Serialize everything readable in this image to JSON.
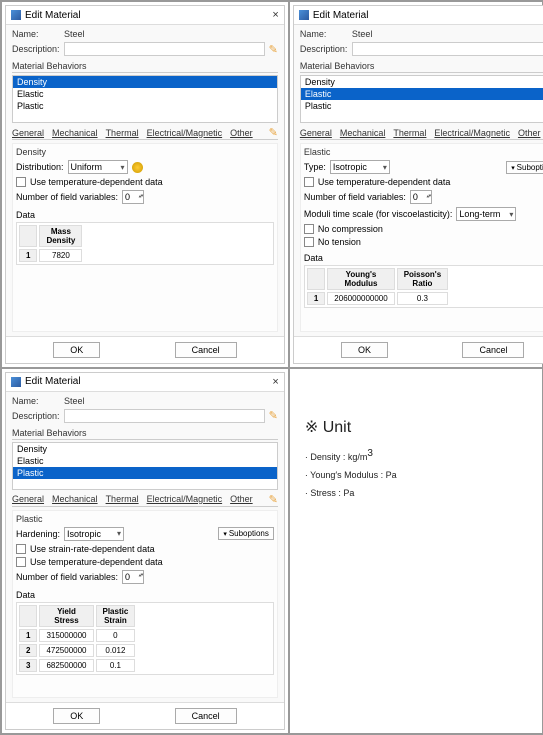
{
  "dialog_title": "Edit Material",
  "name_label": "Name:",
  "name_value": "Steel",
  "desc_label": "Description:",
  "behaviors_label": "Material Behaviors",
  "behaviors": [
    "Density",
    "Elastic",
    "Plastic"
  ],
  "tabs": {
    "general": "General",
    "mechanical": "Mechanical",
    "thermal": "Thermal",
    "electrical": "Electrical/Magnetic",
    "other": "Other"
  },
  "density": {
    "title": "Density",
    "distribution_label": "Distribution:",
    "distribution_value": "Uniform",
    "use_temp": "Use temperature-dependent data",
    "nfield": "Number of field variables:",
    "nfield_val": "0",
    "data_label": "Data",
    "col": "Mass\nDensity",
    "rows": [
      {
        "n": "1",
        "v": "7820"
      }
    ]
  },
  "elastic": {
    "title": "Elastic",
    "type_label": "Type:",
    "type_value": "Isotropic",
    "suboptions": "Suboptions",
    "use_temp": "Use temperature-dependent data",
    "nfield": "Number of field variables:",
    "nfield_val": "0",
    "moduli_label": "Moduli time scale (for viscoelasticity):",
    "moduli_value": "Long-term",
    "no_comp": "No compression",
    "no_tens": "No tension",
    "data_label": "Data",
    "col1": "Young's\nModulus",
    "col2": "Poisson's\nRatio",
    "rows": [
      {
        "n": "1",
        "ym": "206000000000",
        "pr": "0.3"
      }
    ]
  },
  "plastic": {
    "title": "Plastic",
    "hardening_label": "Hardening:",
    "hardening_value": "Isotropic",
    "suboptions": "Suboptions",
    "use_strain": "Use strain-rate-dependent data",
    "use_temp": "Use temperature-dependent data",
    "nfield": "Number of field variables:",
    "nfield_val": "0",
    "data_label": "Data",
    "col1": "Yield\nStress",
    "col2": "Plastic\nStrain",
    "rows": [
      {
        "n": "1",
        "ys": "315000000",
        "ps": "0"
      },
      {
        "n": "2",
        "ys": "472500000",
        "ps": "0.012"
      },
      {
        "n": "3",
        "ys": "682500000",
        "ps": "0.1"
      }
    ]
  },
  "buttons": {
    "ok": "OK",
    "cancel": "Cancel"
  },
  "units": {
    "head": "※ Unit",
    "l1a": "· Density : kg/m",
    "l1b": "3",
    "l2": "· Young′s Modulus :  Pa",
    "l3": "· Stress : Pa"
  }
}
